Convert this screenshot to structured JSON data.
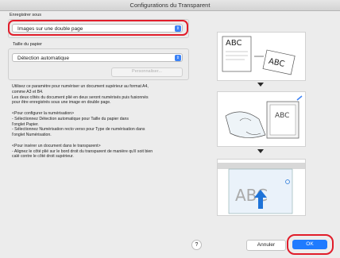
{
  "window": {
    "title": "Configurations du Transparent"
  },
  "save_as": {
    "label": "Enregistrer sous",
    "selected": "Images sur une double page"
  },
  "paper": {
    "label": "Taille du papier",
    "selected": "Détection automatique",
    "customize_label": "Personnaliser..."
  },
  "description": {
    "text": "Utilisez ce paramètre pour numériser un document supérieur au format A4,\ncomme A3 et B4.\nLes deux côtés du document plié en deux seront numérisés puis fusionnés\npour être enregistrés sous une image en double page.\n\n<Pour configurer la numérisation>\n- Sélectionnez Détection automatique pour Taille du papier dans\nl'onglet Papier.\n- Sélectionnez Numérisation recto verso pour Type de numérisation dans\nl'onglet Numérisation.\n\n<Pour insérer un document dans le transparent>\n- Alignez le côté plié sur le bord droit du transparent de manière qu'il soit bien\ncalé contre le côté droit supérieur."
  },
  "illustration": {
    "abc_text": "ABC",
    "abc_text_small": "ABC",
    "abc_text_scan": "ABC"
  },
  "footer": {
    "help_label": "?",
    "cancel_label": "Annuler",
    "ok_label": "OK"
  },
  "colors": {
    "accent": "#3b82f6",
    "highlight": "#e11d2a"
  }
}
